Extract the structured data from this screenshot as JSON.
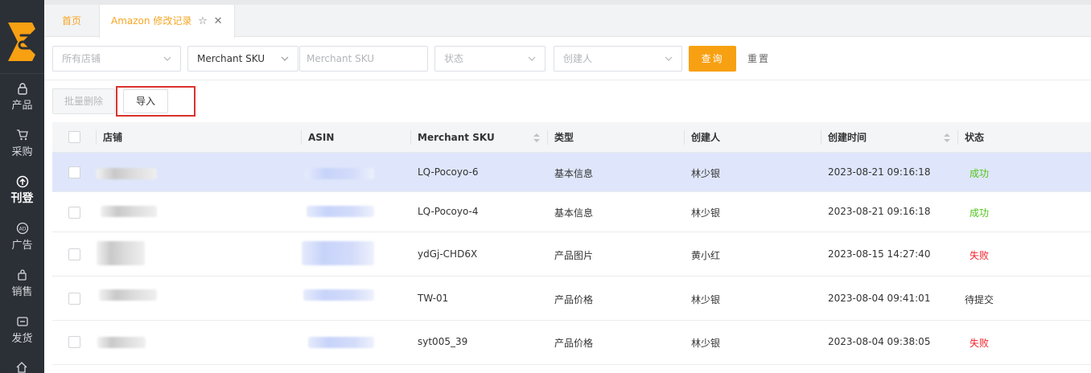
{
  "sidebar": {
    "items": [
      {
        "label": "产品",
        "icon": "lock-icon"
      },
      {
        "label": "采购",
        "icon": "cart-icon"
      },
      {
        "label": "刊登",
        "icon": "upload-circle-icon"
      },
      {
        "label": "广告",
        "icon": "ad-icon"
      },
      {
        "label": "销售",
        "icon": "sales-icon"
      },
      {
        "label": "发货",
        "icon": "shipping-icon"
      }
    ]
  },
  "tabs": {
    "home": "首页",
    "active": "Amazon 修改记录"
  },
  "filters": {
    "store_placeholder": "所有店铺",
    "sku_type": "Merchant SKU",
    "sku_placeholder": "Merchant SKU",
    "status_placeholder": "状态",
    "creator_placeholder": "创建人",
    "query_label": "查询",
    "reset_label": "重置"
  },
  "actions": {
    "batch_delete_label": "批量删除",
    "import_label": "导入"
  },
  "table": {
    "headers": {
      "store": "店铺",
      "asin": "ASIN",
      "sku": "Merchant SKU",
      "type": "类型",
      "creator": "创建人",
      "created_at": "创建时间",
      "status": "状态"
    },
    "rows": [
      {
        "sku": "LQ-Pocoyo-6",
        "type": "基本信息",
        "creator": "林少银",
        "created_at": "2023-08-21 09:16:18",
        "status": "成功",
        "status_kind": "ok"
      },
      {
        "sku": "LQ-Pocoyo-4",
        "type": "基本信息",
        "creator": "林少银",
        "created_at": "2023-08-21 09:16:18",
        "status": "成功",
        "status_kind": "ok"
      },
      {
        "sku": "ydGj-CHD6X",
        "type": "产品图片",
        "creator": "黄小红",
        "created_at": "2023-08-15 14:27:40",
        "status": "失败",
        "status_kind": "fail"
      },
      {
        "sku": "TW-01",
        "type": "产品价格",
        "creator": "林少银",
        "created_at": "2023-08-04 09:41:01",
        "status": "待提交",
        "status_kind": "pending"
      },
      {
        "sku": "syt005_39",
        "type": "产品价格",
        "creator": "林少银",
        "created_at": "2023-08-04 09:38:05",
        "status": "失败",
        "status_kind": "fail"
      }
    ]
  },
  "colors": {
    "accent": "#f7a012",
    "sidebar_bg": "#2b2f36",
    "selected_row": "#dfe6fb",
    "success": "#52c41a",
    "fail": "#f5222d",
    "highlight_box": "#d9332e"
  }
}
